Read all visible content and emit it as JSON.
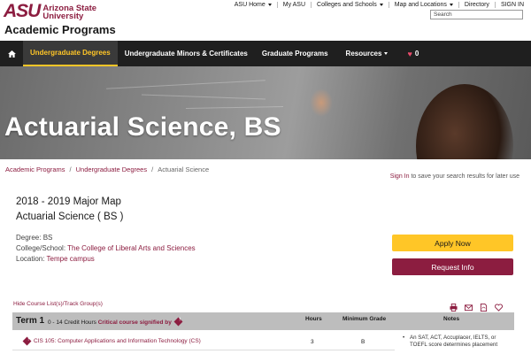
{
  "header": {
    "logo_mark": "ASU",
    "logo_line1": "Arizona State",
    "logo_line2": "University",
    "site_title": "Academic Programs",
    "util_nav": [
      "ASU Home",
      "My ASU",
      "Colleges and Schools",
      "Map and Locations",
      "Directory",
      "SIGN IN"
    ],
    "search_placeholder": "Search"
  },
  "main_nav": {
    "items": [
      "Undergraduate Degrees",
      "Undergraduate Minors & Certificates",
      "Graduate Programs",
      "Resources"
    ],
    "favorites_count": "0"
  },
  "hero": {
    "title": "Actuarial Science, BS"
  },
  "breadcrumb": [
    "Academic Programs",
    "Undergraduate Degrees",
    "Actuarial Science"
  ],
  "signin": {
    "link": "Sign In",
    "text": " to save your search results for later use"
  },
  "major": {
    "map_year": "2018 - 2019 Major Map",
    "name": "Actuarial Science ( BS )",
    "degree_label": "Degree:",
    "degree_value": "BS",
    "college_label": "College/School:",
    "college_value": "The College of Liberal Arts and Sciences",
    "location_label": "Location:",
    "location_value": "Tempe campus"
  },
  "buttons": {
    "apply": "Apply Now",
    "info": "Request Info"
  },
  "hide_link": "Hide Course List(s)/Track Group(s)",
  "term": {
    "title": "Term 1",
    "credits": "0 - 14 Credit Hours",
    "critical": "Critical course signified by",
    "col_hours": "Hours",
    "col_grade": "Minimum Grade",
    "col_notes": "Notes",
    "course": {
      "name": "CIS 105: Computer Applications and Information Technology (CS)",
      "hours": "3",
      "grade": "B"
    },
    "note": "An SAT, ACT, Accuplacer, IELTS, or TOEFL score determines placement"
  },
  "colors": {
    "maroon": "#8c1d40",
    "gold": "#ffc627",
    "nav_bg": "#1f1f1f"
  }
}
